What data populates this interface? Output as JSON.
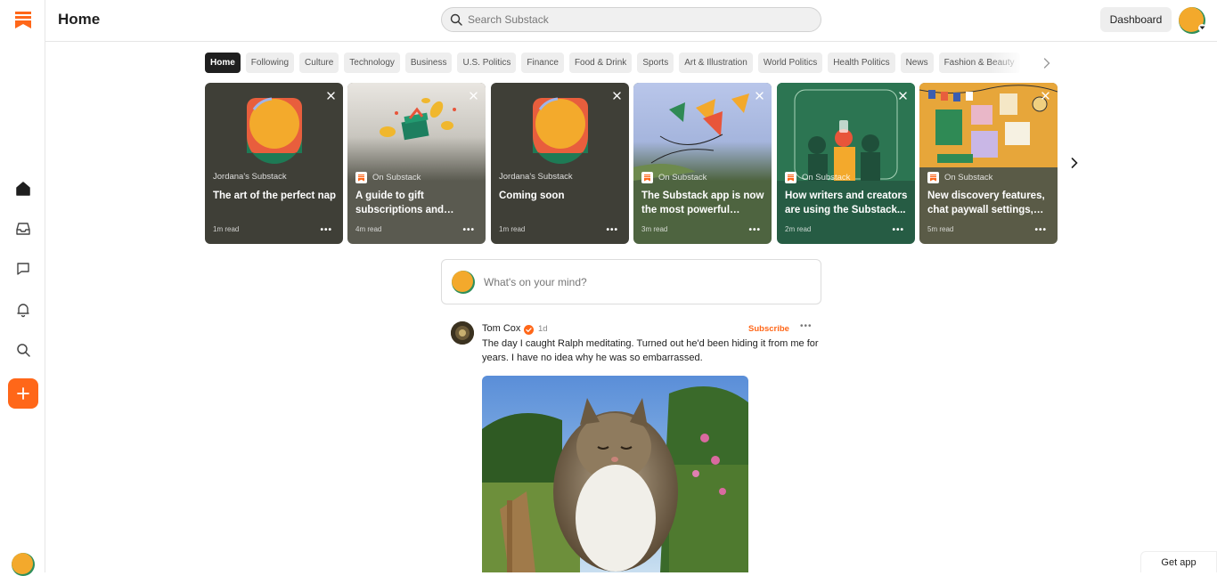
{
  "header": {
    "title": "Home",
    "search_placeholder": "Search Substack",
    "dashboard_label": "Dashboard"
  },
  "rail": {
    "items": [
      {
        "name": "home",
        "icon": "home-icon"
      },
      {
        "name": "inbox",
        "icon": "inbox-icon"
      },
      {
        "name": "chat",
        "icon": "chat-icon"
      },
      {
        "name": "activity",
        "icon": "bell-icon"
      },
      {
        "name": "search",
        "icon": "search-icon"
      },
      {
        "name": "create",
        "icon": "plus-icon"
      }
    ]
  },
  "tabs": [
    "Home",
    "Following",
    "Culture",
    "Technology",
    "Business",
    "U.S. Politics",
    "Finance",
    "Food & Drink",
    "Sports",
    "Art & Illustration",
    "World Politics",
    "Health Politics",
    "News",
    "Fashion & Beauty"
  ],
  "active_tab": "Home",
  "cards": [
    {
      "source": "Jordana's Substack",
      "title": "The art of the perfect nap",
      "read_time": "1m read"
    },
    {
      "source": "On Substack",
      "title": "A guide to gift subscriptions and specia...",
      "read_time": "4m read"
    },
    {
      "source": "Jordana's Substack",
      "title": "Coming soon",
      "read_time": "1m read"
    },
    {
      "source": "On Substack",
      "title": "The Substack app is now the most powerful growt...",
      "read_time": "3m read"
    },
    {
      "source": "On Substack",
      "title": "How writers and creators are using the Substack...",
      "read_time": "2m read"
    },
    {
      "source": "On Substack",
      "title": "New discovery features, chat paywall settings, an...",
      "read_time": "5m read"
    }
  ],
  "composer": {
    "placeholder": "What's on your mind?"
  },
  "post": {
    "author": "Tom Cox",
    "time": "1d",
    "subscribe_label": "Subscribe",
    "text": "The day I caught Ralph meditating. Turned out he'd been hiding it from me for years. I have no idea why he was so embarrassed."
  },
  "footer": {
    "get_app_label": "Get app"
  },
  "colors": {
    "brand": "#ff6719",
    "active_tab": "#1f1f1f"
  }
}
